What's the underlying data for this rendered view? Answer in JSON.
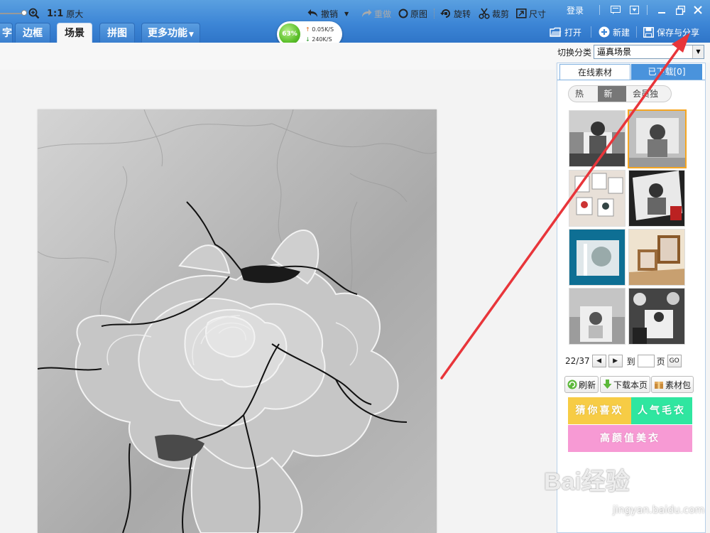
{
  "header": {
    "login": "登录",
    "tabs": [
      {
        "label": "字",
        "active": false
      },
      {
        "label": "边框",
        "active": false
      },
      {
        "label": "场景",
        "active": true
      },
      {
        "label": "拼图",
        "active": false
      },
      {
        "label": "更多功能",
        "active": false
      }
    ],
    "speed": {
      "percent": "63%",
      "upload": "0.05K/S",
      "download": "240K/S"
    },
    "actions": {
      "open": "打开",
      "new": "新建",
      "save_share": "保存与分享"
    }
  },
  "toolbar": {
    "zoom_ratio": "1:1",
    "original_size": "原大",
    "undo": "撤销",
    "redo": "重做",
    "original_image": "原图",
    "rotate": "旋转",
    "crop": "裁剪",
    "size": "尺寸"
  },
  "panel": {
    "switch_label": "切换分类",
    "switch_value": "逼真场景",
    "tabs": {
      "online": "在线素材",
      "downloaded": "已下载[0]"
    },
    "subtabs": [
      {
        "label": "热门",
        "active": false
      },
      {
        "label": "新鲜",
        "active": true
      },
      {
        "label": "会员独享",
        "active": false
      }
    ],
    "pager": {
      "current": "22/37",
      "goto_prefix": "到",
      "goto_suffix": "页",
      "go": "GO",
      "prev": "◀",
      "next": "▶"
    },
    "buttons": {
      "refresh": "刷新",
      "download_page": "下载本页",
      "package": "素材包"
    },
    "banners": {
      "guess": "猜你喜欢",
      "popular": "人气毛衣",
      "beauty": "高颜值美衣"
    }
  },
  "watermark": {
    "logo": "Bai经验",
    "sub": "jingyan.baidu.com"
  },
  "colors": {
    "topbar": "#3d86d6",
    "accent_orange": "#f5a623",
    "banner_yellow": "#f7cc45",
    "banner_green": "#2fe6a0",
    "banner_pink": "#f79ad4",
    "arrow_red": "#e8353a"
  }
}
